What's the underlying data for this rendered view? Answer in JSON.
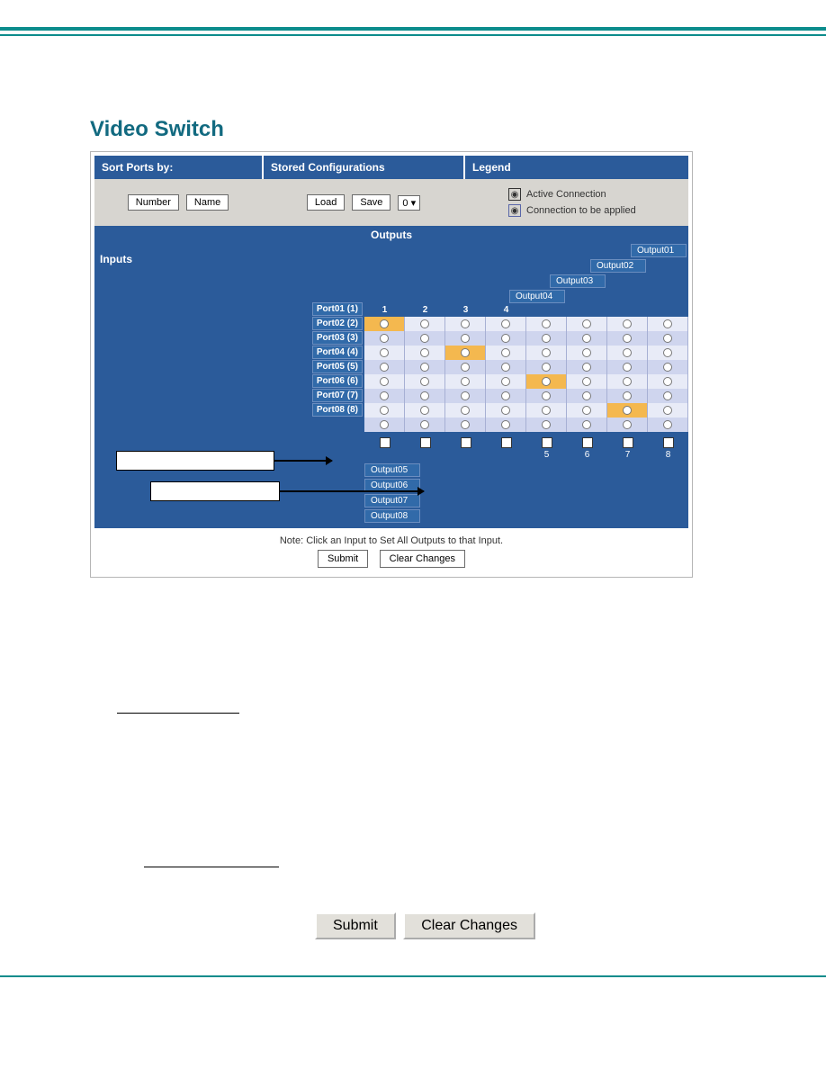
{
  "title": "Video Switch",
  "headers": {
    "sort": "Sort Ports by:",
    "stored": "Stored Configurations",
    "legend": "Legend"
  },
  "buttons": {
    "number": "Number",
    "name": "Name",
    "load": "Load",
    "save": "Save",
    "submit": "Submit",
    "clear": "Clear Changes"
  },
  "dropdown": {
    "selected": "0"
  },
  "legend": {
    "active": "Active Connection",
    "applied": "Connection to be applied"
  },
  "labels": {
    "outputs": "Outputs",
    "inputs": "Inputs"
  },
  "outputs_top": [
    "Output01",
    "Output02",
    "Output03",
    "Output04"
  ],
  "col_nums_top": [
    "1",
    "2",
    "3",
    "4",
    "",
    "",
    "",
    ""
  ],
  "ports": [
    "Port01 (1)",
    "Port02 (2)",
    "Port03 (3)",
    "Port04 (4)",
    "Port05 (5)",
    "Port06 (6)",
    "Port07 (7)",
    "Port08 (8)"
  ],
  "active_map": [
    [
      true,
      false,
      false,
      false,
      false,
      false,
      false,
      false
    ],
    [
      false,
      true,
      false,
      false,
      false,
      false,
      false,
      false
    ],
    [
      false,
      false,
      true,
      false,
      false,
      false,
      false,
      false
    ],
    [
      false,
      false,
      false,
      true,
      false,
      false,
      false,
      false
    ],
    [
      false,
      false,
      false,
      false,
      true,
      false,
      false,
      false
    ],
    [
      false,
      false,
      false,
      false,
      false,
      true,
      false,
      false
    ],
    [
      false,
      false,
      false,
      false,
      false,
      false,
      true,
      false
    ],
    [
      false,
      false,
      false,
      false,
      false,
      false,
      false,
      true
    ]
  ],
  "col_nums_bottom": [
    "",
    "",
    "",
    "",
    "5",
    "6",
    "7",
    "8"
  ],
  "outputs_bottom": [
    "Output05",
    "Output06",
    "Output07",
    "Output08"
  ],
  "note": "Note: Click an Input to Set All Outputs to that Input.",
  "big_buttons": {
    "submit": "Submit",
    "clear": "Clear Changes"
  }
}
